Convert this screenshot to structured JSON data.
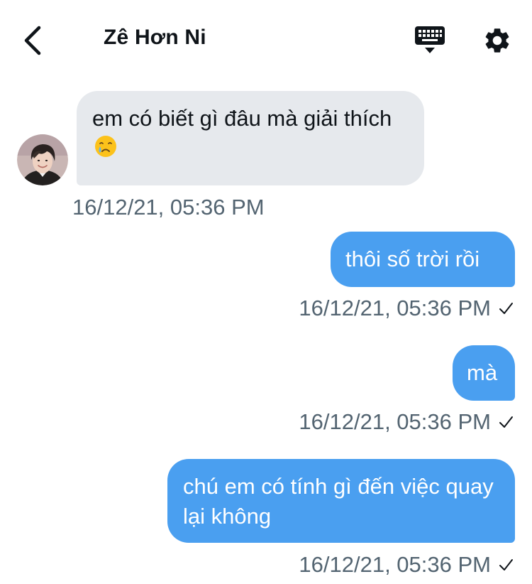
{
  "header": {
    "title": "Zê Hơn Ni",
    "back_icon": "chevron-left-icon",
    "keyboard_icon": "keyboard-icon",
    "settings_icon": "gear-icon"
  },
  "messages": [
    {
      "direction": "incoming",
      "text": "em có biết gì đâu mà giải thích",
      "emoji": "crying-face",
      "timestamp": "16/12/21, 05:36 PM"
    },
    {
      "direction": "outgoing",
      "text": "thôi số trời rồi",
      "timestamp": "16/12/21, 05:36 PM",
      "status": "sent"
    },
    {
      "direction": "outgoing",
      "text": "mà",
      "timestamp": "16/12/21, 05:36 PM",
      "status": "sent"
    },
    {
      "direction": "outgoing",
      "text": "chú em có tính gì đến việc quay lại không",
      "timestamp": "16/12/21, 05:36 PM",
      "status": "sent"
    }
  ],
  "colors": {
    "outgoing_bubble": "#4a9ff0",
    "incoming_bubble": "#e6e9ed",
    "timestamp_text": "#536471"
  }
}
